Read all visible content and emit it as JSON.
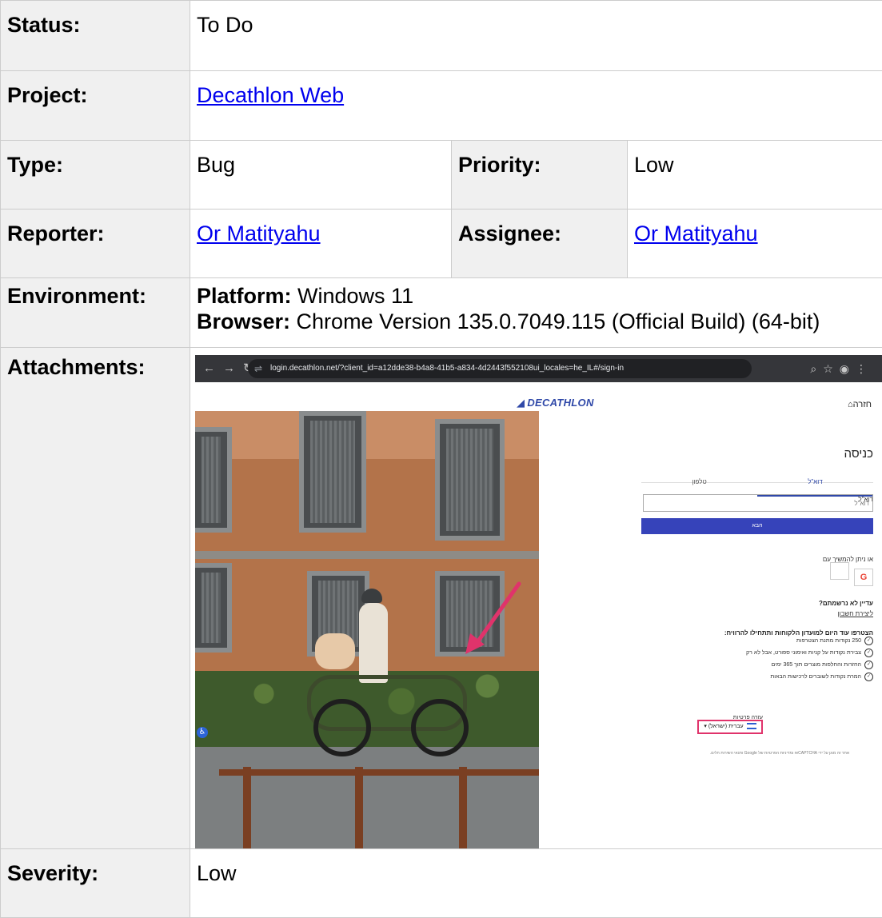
{
  "fields": {
    "status": {
      "label": "Status:",
      "value": "To Do"
    },
    "project": {
      "label": "Project:",
      "value": "Decathlon Web"
    },
    "type": {
      "label": "Type:",
      "value": "Bug"
    },
    "priority": {
      "label": "Priority:",
      "value": "Low"
    },
    "reporter": {
      "label": "Reporter:",
      "value": "Or Matityahu"
    },
    "assignee": {
      "label": "Assignee:",
      "value": "Or Matityahu"
    },
    "environment": {
      "label": "Environment:",
      "platform_label": "Platform:",
      "platform_value": "Windows 11",
      "browser_label": "Browser:",
      "browser_value": "Chrome Version 135.0.7049.115 (Official Build) (64-bit)"
    },
    "attachments": {
      "label": "Attachments:"
    },
    "severity": {
      "label": "Severity:",
      "value": "Low"
    }
  },
  "attachment_screenshot": {
    "url": "login.decathlon.net/?client_id=a12dde38-b4a8-41b5-a834-4d2443f552108ui_locales=he_IL#/sign-in",
    "logo": "DECATHLON",
    "home_link": "חזרה",
    "form": {
      "title": "כניסה",
      "tab_email": "דוא\"ל",
      "tab_phone": "טלפון",
      "email_label": "דוא\"ל",
      "email_placeholder": "דוא\"ל",
      "next_button": "הבא",
      "or_continue": "או ניתן להמשיך עם",
      "not_registered": "עדיין לא נרשמתם?",
      "create_account": "ליצירת חשבון",
      "join_text": "הצטרפו עוד היום למועדון הלקוחות ותתחילו להרוויח:",
      "bullets": [
        "250 נקודות מתנת הצטרפות",
        "צבירת נקודות על קניות ואימוני ספורט, אבל לא רק",
        "החזרות והחלפות מוצרים תוך 365 ימים",
        "המרת נקודות לשוברים לרכישות הבאות"
      ],
      "footer_links": "עזרה   פרטיות",
      "language": "עברית (ישראל)",
      "recaptcha": "אתר זה מוגן על ידי reCAPTCHA ומדיניות הפרטיות של Google ותנאי השירות חלים."
    },
    "colors": {
      "accent": "#3643ba",
      "highlight": "#e0336b",
      "logo": "#2f48a8"
    }
  }
}
